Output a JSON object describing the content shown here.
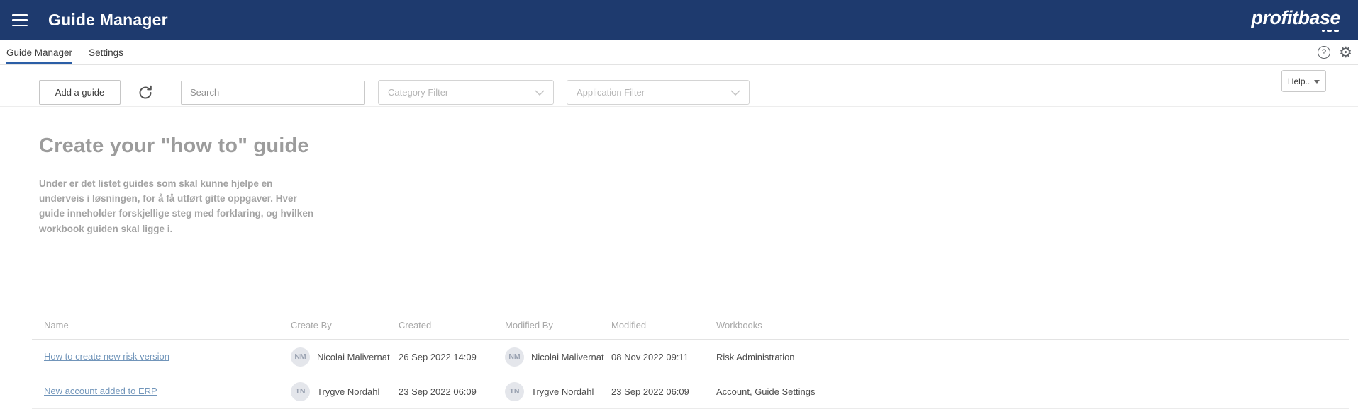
{
  "header": {
    "title": "Guide Manager",
    "logo_text": "profitbase"
  },
  "nav": {
    "tabs": [
      {
        "label": "Guide Manager",
        "active": true
      },
      {
        "label": "Settings",
        "active": false
      }
    ]
  },
  "toolbar": {
    "add_guide_label": "Add a guide",
    "search_placeholder": "Search",
    "category_filter_placeholder": "Category Filter",
    "application_filter_placeholder": "Application Filter",
    "help_button_label": "Help.."
  },
  "content": {
    "heading": "Create your \"how to\" guide",
    "description": "Under er det listet guides som skal kunne hjelpe en underveis i løsningen, for å få utført gitte oppgaver.  Hver guide inneholder forskjellige steg med forklaring, og hvilken workbook guiden skal ligge i."
  },
  "table": {
    "columns": [
      "Name",
      "Create By",
      "Created",
      "Modified By",
      "Modified",
      "Workbooks"
    ],
    "rows": [
      {
        "name": "How to create new risk version",
        "create_by_initials": "NM",
        "create_by": "Nicolai Malivernat",
        "created": "26 Sep 2022 14:09",
        "modified_by_initials": "NM",
        "modified_by": "Nicolai Malivernat",
        "modified": "08 Nov 2022 09:11",
        "workbooks": "Risk Administration"
      },
      {
        "name": "New account added to ERP",
        "create_by_initials": "TN",
        "create_by": "Trygve Nordahl",
        "created": "23 Sep 2022 06:09",
        "modified_by_initials": "TN",
        "modified_by": "Trygve Nordahl",
        "modified": "23 Sep 2022 06:09",
        "workbooks": "Account, Guide Settings"
      }
    ]
  },
  "colors": {
    "header_bg": "#1e3a6e",
    "active_tab_underline": "#2b5ea6",
    "link": "#7195ba"
  }
}
